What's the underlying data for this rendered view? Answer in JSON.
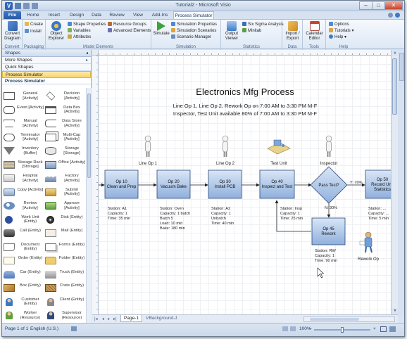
{
  "window": {
    "title": "Tutorial2 - Microsoft Visio"
  },
  "tabs": [
    "File",
    "Home",
    "Insert",
    "Design",
    "Data",
    "Review",
    "View",
    "Add-Ins",
    "Process Simulator"
  ],
  "ribbon": {
    "convert": {
      "button": "Convert Diagram",
      "group": "Convert"
    },
    "packaging": {
      "create": "Create",
      "install": "Install",
      "group": "Packaging"
    },
    "model_elements": {
      "object_explorer": "Object Explorer",
      "shape_properties": "Shape Properties",
      "variables": "Variables",
      "attributes": "Attributes",
      "resource_groups": "Resource Groups",
      "advanced_elements": "Advanced Elements",
      "group": "Model Elements"
    },
    "simulation": {
      "simulate": "Simulate",
      "simulation_properties": "Simulation Properties",
      "simulation_scenarios": "Simulation Scenarios",
      "scenario_manager": "Scenario Manager",
      "group": "Simulation"
    },
    "statistics": {
      "output_viewer": "Output Viewer",
      "six_sigma": "Six Sigma Analysis",
      "minitab": "Minitab",
      "group": "Statistics"
    },
    "data": {
      "import_export": "Import / Export",
      "group": "Data"
    },
    "tools": {
      "calendar_editor": "Calendar Editor",
      "group": "Tools"
    },
    "help": {
      "options": "Options",
      "tutorials": "Tutorials",
      "help": "Help",
      "group": "Help"
    }
  },
  "shapes_panel": {
    "header": "Shapes",
    "more_shapes": "More Shapes",
    "quick_shapes": "Quick Shapes",
    "process_simulator": "Process Simulator",
    "stencil_title": "Process Simulator",
    "items": [
      {
        "label": "General [Activity]",
        "icon": "rect"
      },
      {
        "label": "Decision [Activity]",
        "icon": "diamond"
      },
      {
        "label": "Event [Activity]",
        "icon": "rounded"
      },
      {
        "label": "Data Box [Activity]",
        "icon": "databox"
      },
      {
        "label": "Manual [Activity]",
        "icon": "trapezoid"
      },
      {
        "label": "Data Store [Activity]",
        "icon": "datastore"
      },
      {
        "label": "Terminator [Activity]",
        "icon": "terminator"
      },
      {
        "label": "Multi-Cap [Activity]",
        "icon": "multicap"
      },
      {
        "label": "Inventory (Buffer)",
        "icon": "triangle"
      },
      {
        "label": "Storage [Storage]",
        "icon": "cylinder"
      },
      {
        "label": "Storage Rack [Storage]",
        "icon": "rack"
      },
      {
        "label": "Office [Activity]",
        "icon": "office"
      },
      {
        "label": "Hospital [Activity]",
        "icon": "hospital"
      },
      {
        "label": "Factory [Activity]",
        "icon": "factory"
      },
      {
        "label": "Copy [Activity]",
        "icon": "copy"
      },
      {
        "label": "Submit [Activity]",
        "icon": "submit"
      },
      {
        "label": "Review [Activity]",
        "icon": "review"
      },
      {
        "label": "Approve [Activity]",
        "icon": "approve"
      },
      {
        "label": "Work Unit (Entity)",
        "icon": "circle"
      },
      {
        "label": "Disk (Entity)",
        "icon": "disk"
      },
      {
        "label": "Call (Entity)",
        "icon": "phone"
      },
      {
        "label": "Mail (Entity)",
        "icon": "mail"
      },
      {
        "label": "Document (Entity)",
        "icon": "document"
      },
      {
        "label": "Forms (Entity)",
        "icon": "forms"
      },
      {
        "label": "Order (Entity)",
        "icon": "order"
      },
      {
        "label": "Folder (Entity)",
        "icon": "folder"
      },
      {
        "label": "Car (Entity)",
        "icon": "car"
      },
      {
        "label": "Truck (Entity)",
        "icon": "truck"
      },
      {
        "label": "Box (Entity)",
        "icon": "box"
      },
      {
        "label": "Crate (Entity)",
        "icon": "crate"
      },
      {
        "label": "Customer (Entity)",
        "icon": "customer"
      },
      {
        "label": "Client (Entity)",
        "icon": "client"
      },
      {
        "label": "Worker (Resource)",
        "icon": "worker"
      },
      {
        "label": "Supervisor (Resource)",
        "icon": "supervisor"
      }
    ]
  },
  "diagram": {
    "title": "Electronics Mfg Process",
    "subtitle_line1": "Line Op 1, Line Op 2, Rework Op on 7:00 AM to 3:30 PM M-F",
    "subtitle_line2": "Inspector, Test Unit available 80% of 7:00 AM to 3:30 PM M-F",
    "resources": [
      "Line Op 1",
      "Line Op 2",
      "Test Unit",
      "Inspector",
      "Rework Op"
    ],
    "ops": [
      {
        "label": "Op 10\nClean and Prep",
        "stats": [
          "Station: A1",
          "Capacity: 1",
          "Time: 35 min"
        ]
      },
      {
        "label": "Op 20\nVacuum Bake",
        "stats": [
          "Station: Oven",
          "Capacity: 1 batch",
          "Batch 5",
          "Load: 10 min",
          "Bake: 180 min"
        ]
      },
      {
        "label": "Op 30\nInstall PCB",
        "stats": [
          "Station: A2",
          "Capacity: 1",
          "Unbatch",
          "Time: 40 min"
        ]
      },
      {
        "label": "Op 40\nInspect and Test",
        "stats": [
          "Station: Insp",
          "Capacity: 1",
          "Time: 25 min"
        ]
      },
      {
        "label": "Op 45\nRework",
        "stats": [
          "Station: RW",
          "Capacity: 1",
          "Time: 90 min"
        ]
      },
      {
        "label": "Op 50\nRecord Unit\nStatistics",
        "stats": [
          "Station: ...",
          "Capacity: ...",
          "Time: 5 min"
        ]
      }
    ],
    "decision": "Pass Test?",
    "yes_label": "Y: 70%",
    "no_label": "N: 30%"
  },
  "page_tabs": {
    "page1": "Page-1",
    "background": "VBackground-1"
  },
  "status": {
    "page": "Page 1 of 1",
    "language": "English (U.S.)",
    "zoom": "100%"
  }
}
